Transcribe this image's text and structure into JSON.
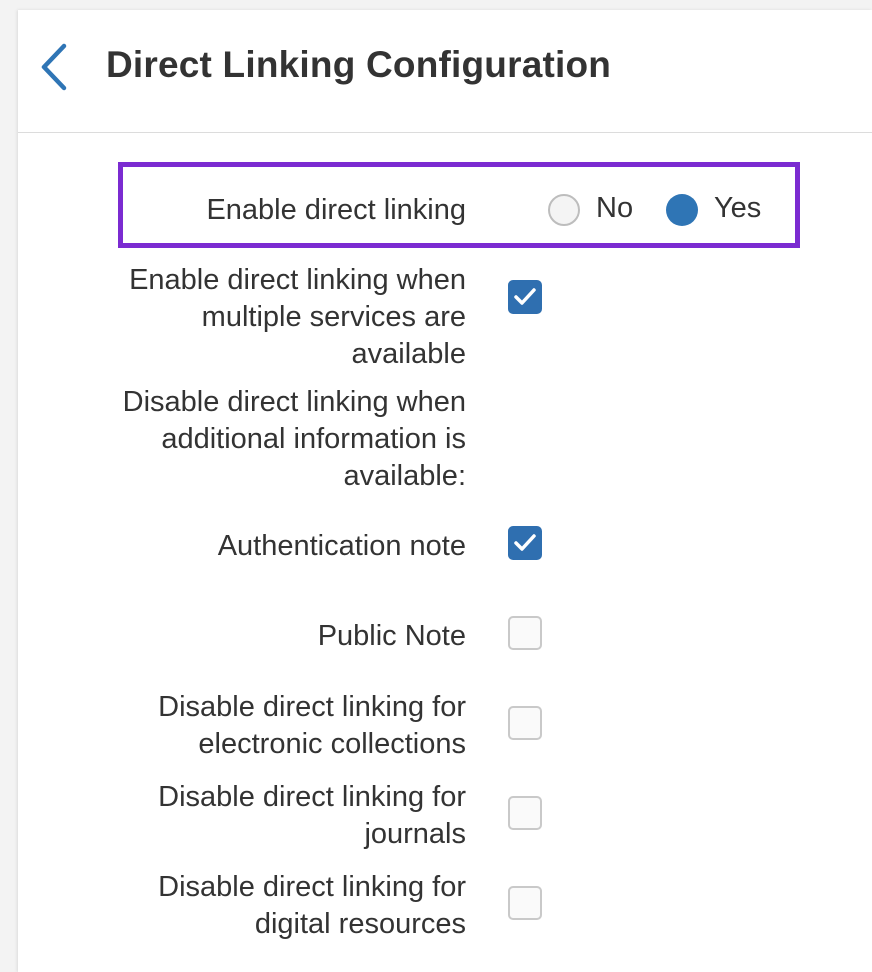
{
  "header": {
    "title": "Direct Linking Configuration",
    "back_icon": "chevron-left-icon"
  },
  "colors": {
    "accent": "#2f75b5",
    "highlight_border": "#7b2bd1"
  },
  "enable_direct_linking": {
    "label": "Enable direct linking",
    "options": [
      {
        "label": "No",
        "selected": false
      },
      {
        "label": "Yes",
        "selected": true
      }
    ]
  },
  "settings": {
    "multiple_services": {
      "label_lines": [
        "Enable direct linking when",
        "multiple services are",
        "available"
      ],
      "checked": true
    },
    "additional_info_heading": {
      "label_lines": [
        "Disable direct linking when",
        "additional information is",
        "available:"
      ]
    },
    "authentication_note": {
      "label": "Authentication note",
      "checked": true
    },
    "public_note": {
      "label": "Public Note",
      "checked": false
    },
    "electronic_collections": {
      "label_lines": [
        "Disable direct linking for",
        "electronic collections"
      ],
      "checked": false
    },
    "journals": {
      "label_lines": [
        "Disable direct linking for",
        "journals"
      ],
      "checked": false
    },
    "digital_resources": {
      "label_lines": [
        "Disable direct linking for",
        "digital resources"
      ],
      "checked": false
    }
  }
}
